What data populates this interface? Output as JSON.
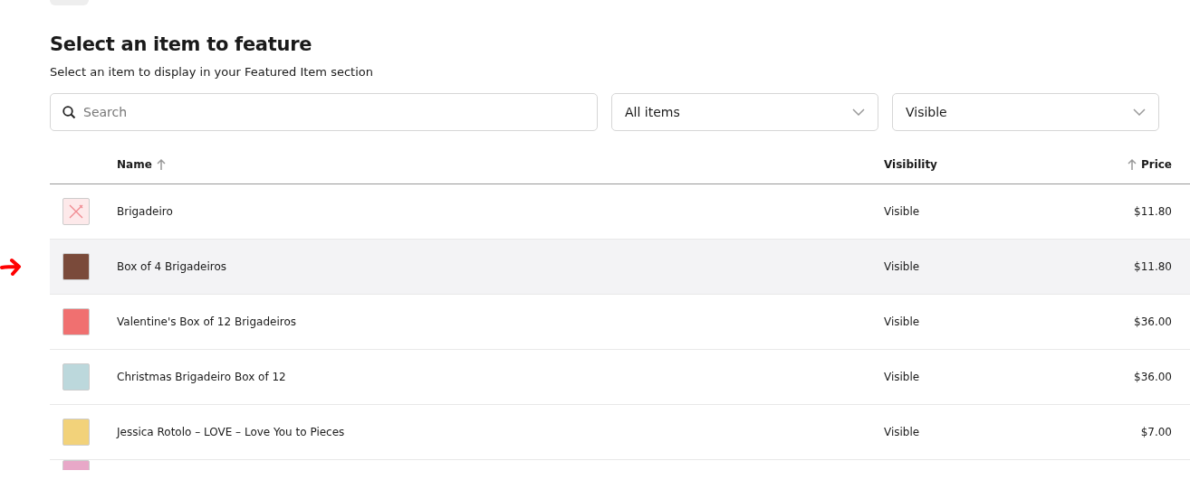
{
  "title": "Select an item to feature",
  "subtitle": "Select an item to display in your Featured Item section",
  "search": {
    "placeholder": "Search"
  },
  "filters": [
    {
      "value": "All items"
    },
    {
      "value": "Visible"
    }
  ],
  "table": {
    "columns": [
      {
        "label": "Name",
        "sorted": true
      },
      {
        "label": "Visibility",
        "sorted": false
      },
      {
        "label": "Price",
        "sorted": true
      }
    ],
    "rows": [
      {
        "thumbnail": {
          "kind": "placeholder"
        },
        "name": "Brigadeiro",
        "visibility": "Visible",
        "price": "$11.80",
        "selected": false
      },
      {
        "thumbnail": {
          "kind": "photo",
          "color": "#7a4a3a"
        },
        "name": "Box of 4 Brigadeiros",
        "visibility": "Visible",
        "price": "$11.80",
        "selected": true
      },
      {
        "thumbnail": {
          "kind": "photo",
          "color": "#f07070"
        },
        "name": "Valentine's Box of 12 Brigadeiros",
        "visibility": "Visible",
        "price": "$36.00",
        "selected": false
      },
      {
        "thumbnail": {
          "kind": "photo",
          "color": "#bcd8dc"
        },
        "name": "Christmas Brigadeiro Box of 12",
        "visibility": "Visible",
        "price": "$36.00",
        "selected": false
      },
      {
        "thumbnail": {
          "kind": "photo",
          "color": "#f2d27a"
        },
        "name": "Jessica Rotolo – LOVE – Love You to Pieces",
        "visibility": "Visible",
        "price": "$7.00",
        "selected": false
      },
      {
        "thumbnail": {
          "kind": "photo",
          "color": "#e8a8c8"
        },
        "selected": false
      }
    ]
  }
}
